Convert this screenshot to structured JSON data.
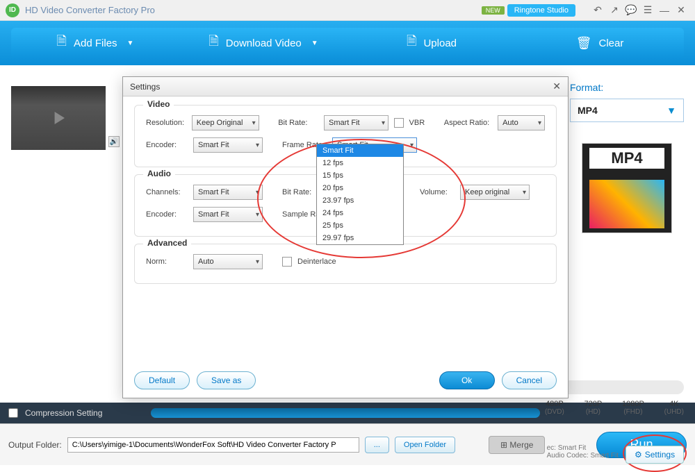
{
  "app": {
    "title": "HD Video Converter Factory Pro",
    "new_badge": "NEW",
    "ringtone": "Ringtone Studio"
  },
  "toolbar": {
    "add_files": "Add Files",
    "download_video": "Download Video",
    "upload": "Upload",
    "clear": "Clear"
  },
  "format": {
    "label": "Format:",
    "selected": "MP4",
    "card": "MP4"
  },
  "quality": {
    "items": [
      {
        "res": "480P",
        "tag": "(DVD)"
      },
      {
        "res": "720P",
        "tag": "(HD)"
      },
      {
        "res": "1080P",
        "tag": "(FHD)"
      },
      {
        "res": "4K",
        "tag": "(UHD)"
      }
    ]
  },
  "codec": {
    "video": "ec: Smart Fit",
    "audio": "Audio Codec: Smart Fit"
  },
  "settings_btn": "Settings",
  "dialog": {
    "title": "Settings",
    "video": {
      "legend": "Video",
      "resolution_label": "Resolution:",
      "resolution_value": "Keep Original",
      "bitrate_label": "Bit Rate:",
      "bitrate_value": "Smart Fit",
      "vbr": "VBR",
      "aspect_label": "Aspect Ratio:",
      "aspect_value": "Auto",
      "encoder_label": "Encoder:",
      "encoder_value": "Smart Fit",
      "framerate_label": "Frame Rate:",
      "framerate_value": "Smart Fit",
      "framerate_options": [
        "Smart Fit",
        "12 fps",
        "15 fps",
        "20 fps",
        "23.97 fps",
        "24 fps",
        "25 fps",
        "29.97 fps"
      ]
    },
    "audio": {
      "legend": "Audio",
      "channels_label": "Channels:",
      "channels_value": "Smart Fit",
      "bitrate_label": "Bit Rate:",
      "volume_label": "Volume:",
      "volume_value": "Keep original",
      "encoder_label": "Encoder:",
      "encoder_value": "Smart Fit",
      "samplerate_label": "Sample Rate:"
    },
    "advanced": {
      "legend": "Advanced",
      "norm_label": "Norm:",
      "norm_value": "Auto",
      "deinterlace": "Deinterlace"
    },
    "buttons": {
      "default": "Default",
      "save_as": "Save as",
      "ok": "Ok",
      "cancel": "Cancel"
    }
  },
  "bottom": {
    "compression": "Compression Setting",
    "output_label": "Output Folder:",
    "output_path": "C:\\Users\\yimige-1\\Documents\\WonderFox Soft\\HD Video Converter Factory P",
    "open_folder": "Open Folder",
    "merge": "⊞ Merge",
    "run": "Run"
  }
}
